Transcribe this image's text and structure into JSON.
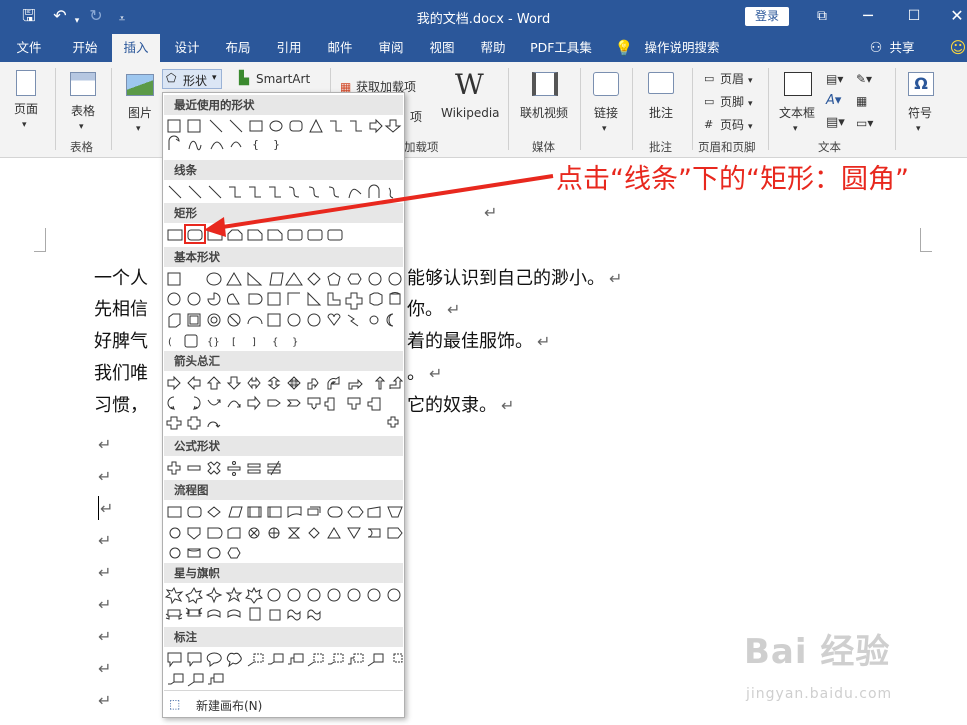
{
  "window": {
    "title": "我的文档.docx  -  Word",
    "login": "登录"
  },
  "quick_access": {
    "save": "save-icon",
    "undo": "undo-icon",
    "redo": "redo-icon",
    "customize": "customize-icon"
  },
  "tabs": [
    {
      "label": "文件"
    },
    {
      "label": "开始"
    },
    {
      "label": "插入"
    },
    {
      "label": "设计"
    },
    {
      "label": "布局"
    },
    {
      "label": "引用"
    },
    {
      "label": "邮件"
    },
    {
      "label": "审阅"
    },
    {
      "label": "视图"
    },
    {
      "label": "帮助"
    },
    {
      "label": "PDF工具集"
    },
    {
      "label": "操作说明搜索"
    }
  ],
  "share": "共享",
  "ribbon": {
    "pages": "页面",
    "table": "表格",
    "table_group": "表格",
    "picture": "图片",
    "shapes": "形状",
    "smartart": "SmartArt",
    "get_addins": "获取加载项",
    "my_addins_fragment": "项",
    "addins_group_fragment": "加载项",
    "wikipedia": "Wikipedia",
    "online_video": "联机视频",
    "media_group": "媒体",
    "link": "链接",
    "comment": "批注",
    "comment_group": "批注",
    "header": "页眉",
    "footer": "页脚",
    "page_number": "页码",
    "header_footer_group": "页眉和页脚",
    "textbox": "文本框",
    "text_group": "文本",
    "symbol": "符号"
  },
  "shapes_menu": {
    "sections": [
      "最近使用的形状",
      "线条",
      "矩形",
      "基本形状",
      "箭头总汇",
      "公式形状",
      "流程图",
      "星与旗帜",
      "标注"
    ],
    "new_canvas": "新建画布(N)"
  },
  "document": {
    "lines": [
      "一个人",
      "先相信",
      "好脾气",
      "我们唯",
      "习惯，"
    ],
    "line_tails": [
      "能够认识到自己的渺小。",
      "你。",
      "着的最佳服饰。",
      "。",
      "它的奴隶。"
    ]
  },
  "annotation": {
    "text": "点击“线条”下的“矩形：圆角”",
    "color": "#e8281e"
  },
  "watermark": {
    "brand": "Bai 经验",
    "url": "jingyan.baidu.com"
  }
}
